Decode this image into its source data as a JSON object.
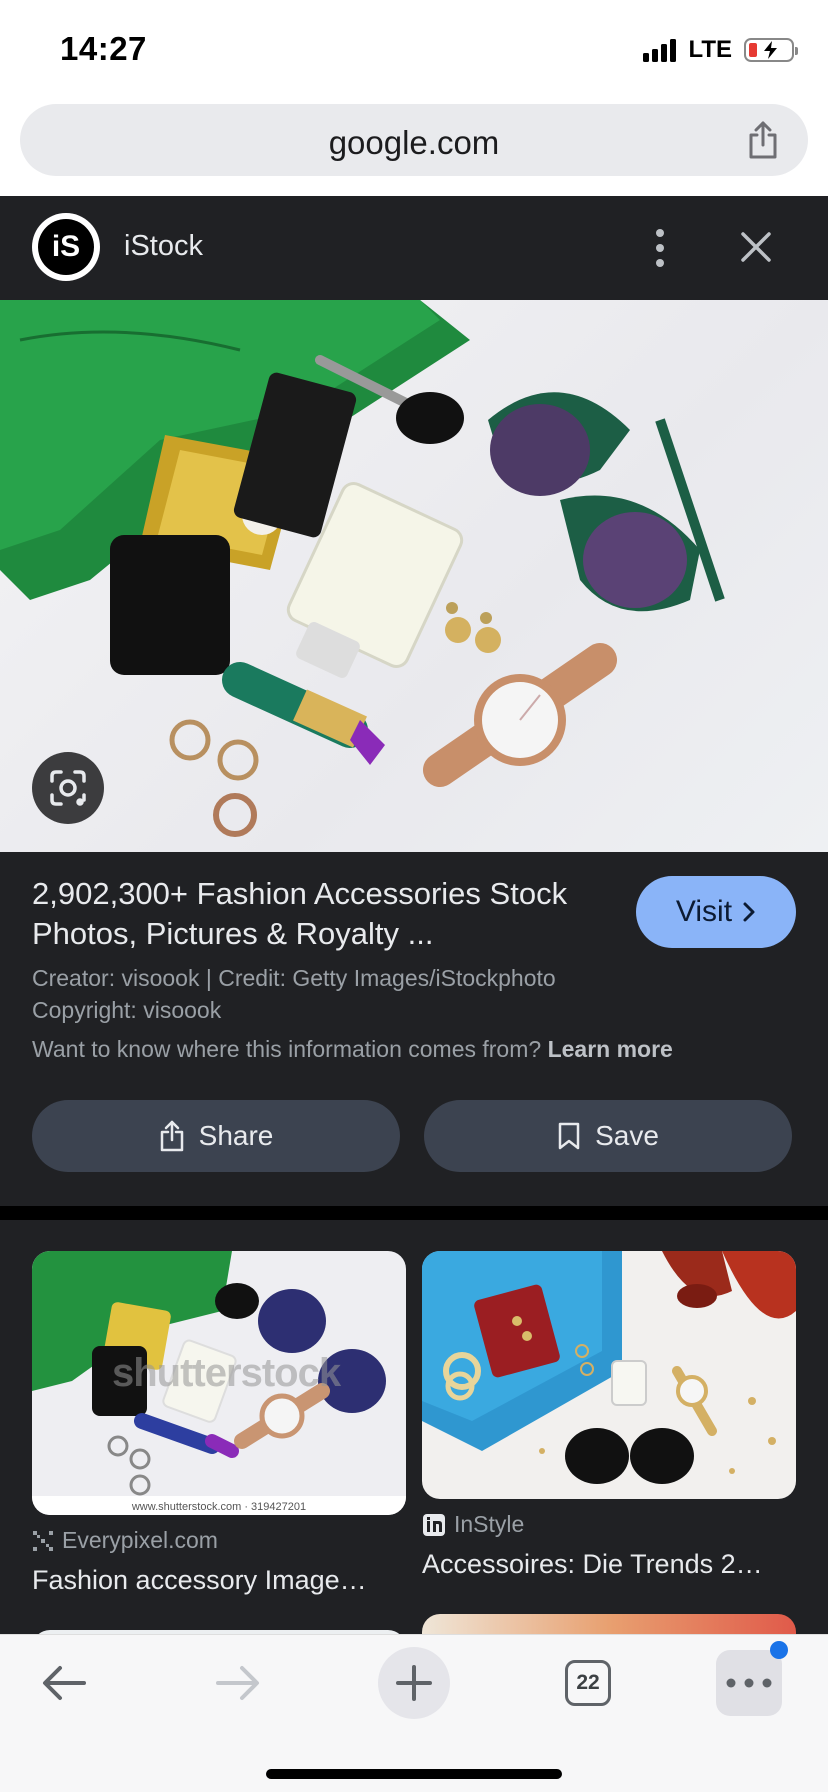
{
  "status": {
    "time": "14:27",
    "network": "LTE",
    "signal_icon": "signal-bars-icon",
    "battery_icon": "battery-charging-icon"
  },
  "browser": {
    "url": "google.com",
    "share_icon": "share-icon"
  },
  "viewer": {
    "source_name": "iStock",
    "logo_text": "iS",
    "more_icon": "more-vert-icon",
    "close_icon": "close-icon",
    "lens_icon": "lens-icon",
    "title": "2,902,300+ Fashion Accessories Stock Photos, Pictures & Royalty ...",
    "visit_label": "Visit",
    "creator_line": "Creator: visoook | Credit: Getty Images/iStockphoto",
    "copyright_line": "Copyright: visoook",
    "info_question": "Want to know where this information comes from?",
    "learn_more": "Learn more",
    "share_label": "Share",
    "save_label": "Save"
  },
  "results": [
    {
      "source": "Everypixel.com",
      "title": "Fashion accessory Image…",
      "watermark": "shutterstock",
      "footer": "www.shutterstock.com · 319427201"
    },
    {
      "source": "InStyle",
      "title": "Accessoires: Die Trends 2…"
    }
  ],
  "toolbar": {
    "tab_count": "22",
    "back_icon": "back-arrow-icon",
    "forward_icon": "forward-arrow-icon",
    "new_tab_icon": "plus-icon",
    "menu_icon": "more-horiz-icon"
  },
  "colors": {
    "panel_bg": "#202124",
    "visit_bg": "#8ab4f8",
    "action_bg": "#3c4350",
    "badge": "#1a73e8"
  }
}
